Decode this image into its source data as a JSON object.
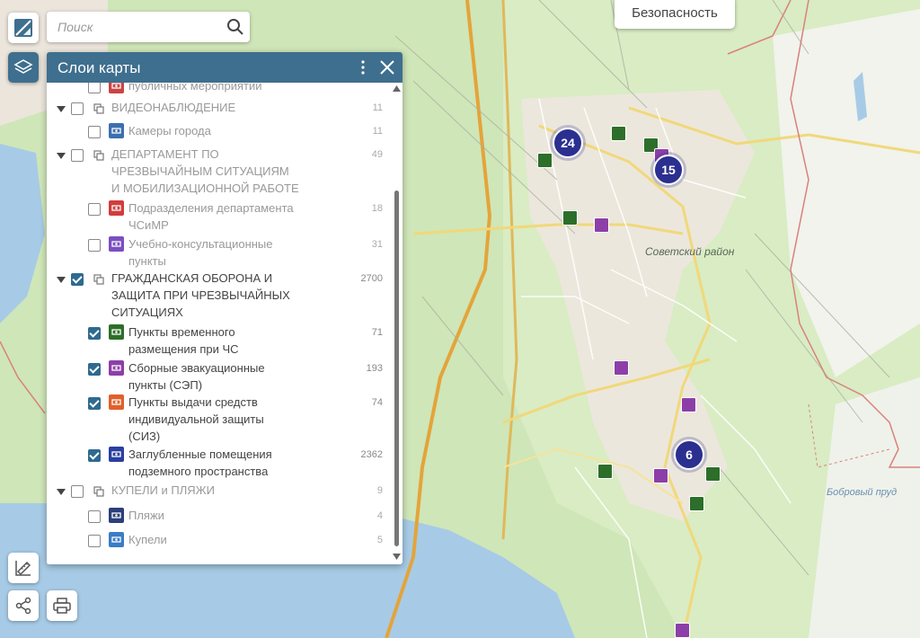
{
  "search": {
    "placeholder": "Поиск"
  },
  "top_button": {
    "label": "Безопасность"
  },
  "panel": {
    "title": "Слои карты",
    "rows": [
      {
        "kind": "item",
        "checked": false,
        "dim": true,
        "icon": "event-icon",
        "icon_color": "#c44",
        "lines": [
          "публичных мероприятий"
        ],
        "count": ""
      },
      {
        "kind": "group",
        "checked": false,
        "dim": true,
        "lines": [
          "ВИДЕОНАБЛЮДЕНИЕ"
        ],
        "count": "11"
      },
      {
        "kind": "item",
        "checked": false,
        "dim": true,
        "icon": "camera-icon",
        "icon_color": "#3c6fb0",
        "lines": [
          "Камеры города"
        ],
        "count": "11"
      },
      {
        "kind": "group",
        "checked": false,
        "dim": true,
        "lines": [
          "ДЕПАРТАМЕНТ ПО",
          "ЧРЕЗВЫЧАЙНЫМ СИТУАЦИЯМ",
          "И МОБИЛИЗАЦИОННОЙ РАБОТЕ"
        ],
        "count": "49"
      },
      {
        "kind": "item",
        "checked": false,
        "dim": true,
        "icon": "megaphone-icon",
        "icon_color": "#d23c3c",
        "lines": [
          "Подразделения департамента",
          "ЧСиМР"
        ],
        "count": "18"
      },
      {
        "kind": "item",
        "checked": false,
        "dim": true,
        "icon": "info-icon",
        "icon_color": "#7a4fc2",
        "lines": [
          "Учебно-консультационные",
          "пункты"
        ],
        "count": "31"
      },
      {
        "kind": "group",
        "checked": true,
        "dim": false,
        "lines": [
          "ГРАЖДАНСКАЯ ОБОРОНА И",
          "ЗАЩИТА ПРИ ЧРЕЗВЫЧАЙНЫХ",
          "СИТУАЦИЯХ"
        ],
        "count": "2700"
      },
      {
        "kind": "item",
        "checked": true,
        "dim": false,
        "icon": "shelter-bed-icon",
        "icon_color": "#2d6e2a",
        "lines": [
          "Пункты временного",
          "размещения при ЧС"
        ],
        "count": "71"
      },
      {
        "kind": "item",
        "checked": true,
        "dim": false,
        "icon": "evacuation-group-icon",
        "icon_color": "#8c3fa8",
        "lines": [
          "Сборные эвакуационные",
          "пункты (СЭП)"
        ],
        "count": "193"
      },
      {
        "kind": "item",
        "checked": true,
        "dim": false,
        "icon": "gas-mask-icon",
        "icon_color": "#e0602a",
        "lines": [
          "Пункты выдачи средств",
          "индивидуальной защиты",
          "(СИЗ)"
        ],
        "count": "74"
      },
      {
        "kind": "item",
        "checked": true,
        "dim": false,
        "icon": "underground-shelter-icon",
        "icon_color": "#2b3fa0",
        "lines": [
          "Заглубленные помещения",
          "подземного пространства"
        ],
        "count": "2362"
      },
      {
        "kind": "group",
        "checked": false,
        "dim": true,
        "lines": [
          "КУПЕЛИ и ПЛЯЖИ"
        ],
        "count": "9"
      },
      {
        "kind": "item",
        "checked": false,
        "dim": true,
        "icon": "beach-icon",
        "icon_color": "#2b3f7a",
        "lines": [
          "Пляжи"
        ],
        "count": "4"
      },
      {
        "kind": "item",
        "checked": false,
        "dim": true,
        "icon": "font-icon",
        "icon_color": "#3a7cc6",
        "lines": [
          "Купели"
        ],
        "count": "5"
      }
    ]
  },
  "map": {
    "district_label": "Советский район",
    "pond_label": "Бобровый пруд",
    "clusters": [
      {
        "count": "24"
      },
      {
        "count": "15"
      },
      {
        "count": "6"
      }
    ]
  }
}
